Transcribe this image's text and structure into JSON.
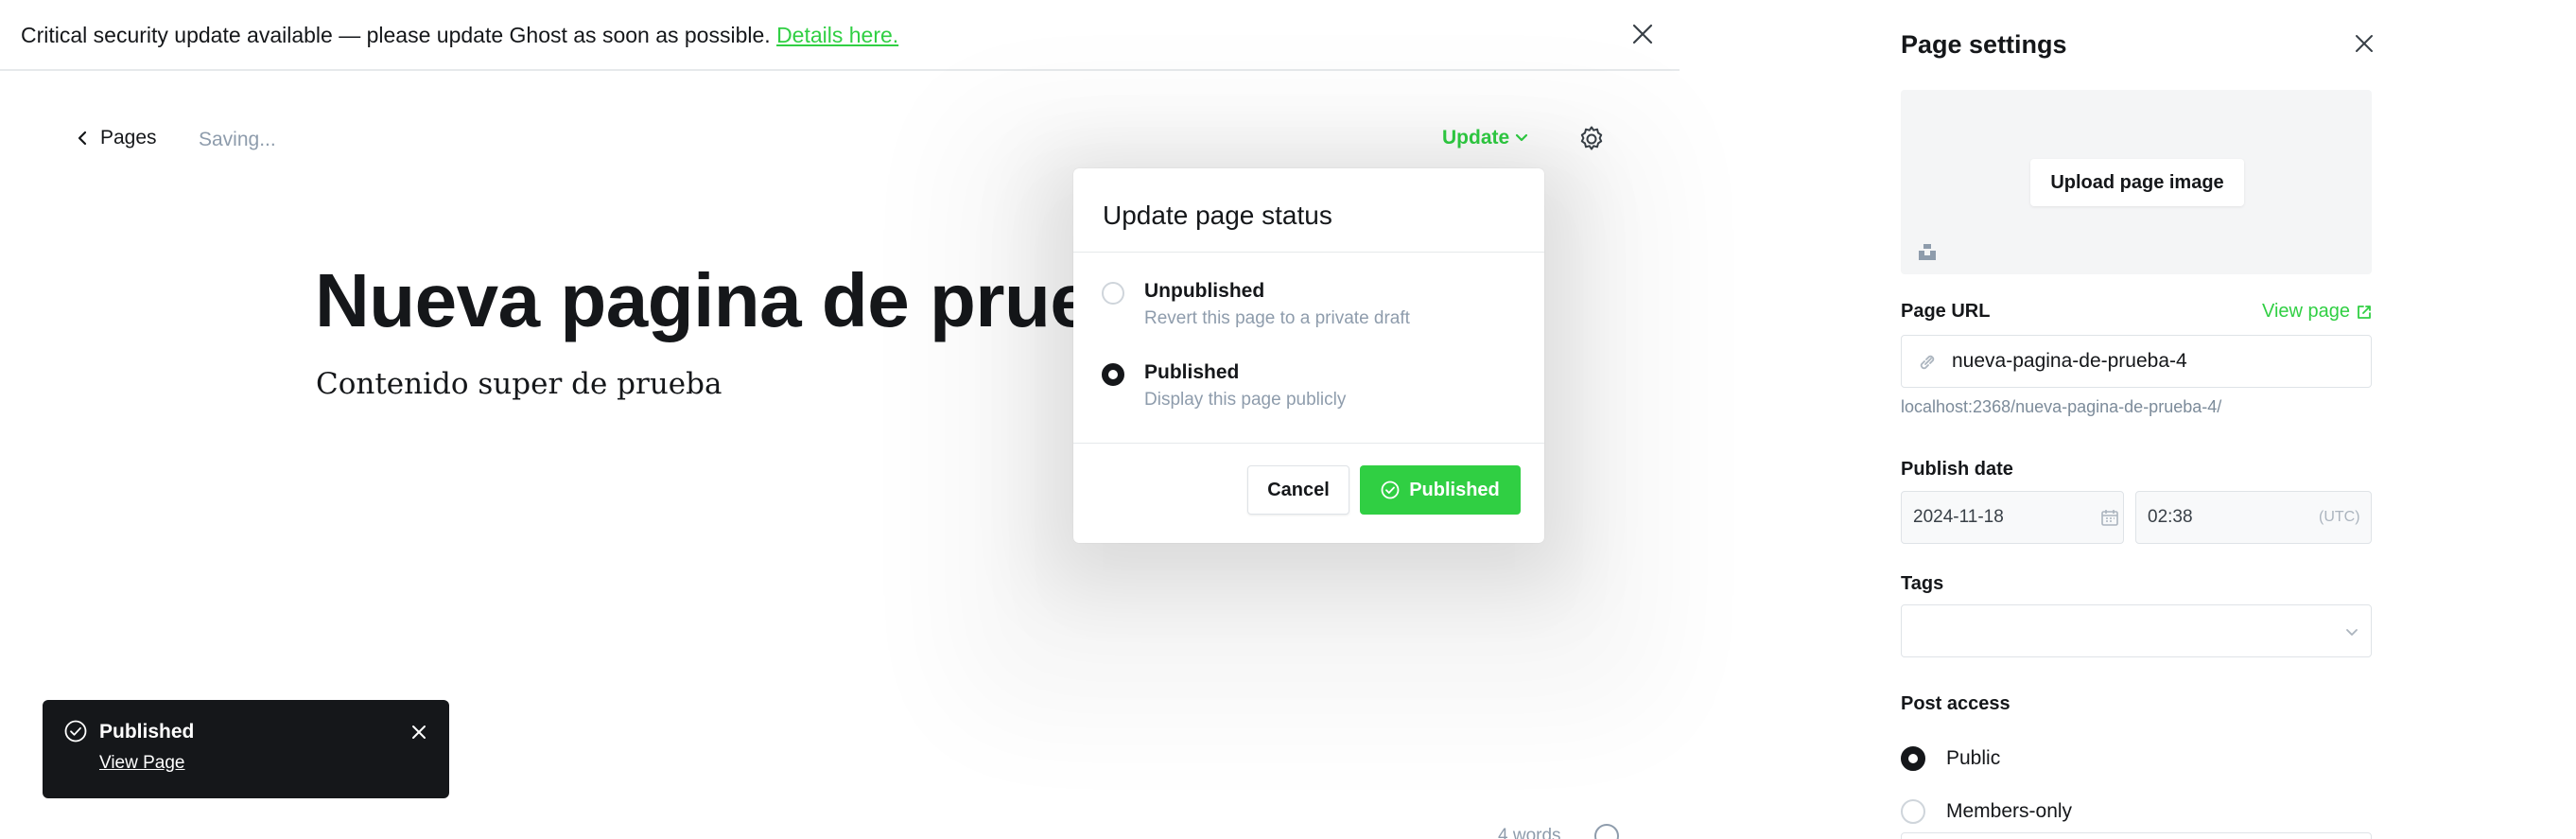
{
  "alert": {
    "message": "Critical security update available — please update Ghost as soon as possible.",
    "link_label": "Details here."
  },
  "editor": {
    "back_label": "Pages",
    "status_text": "Saving...",
    "update_label": "Update",
    "title": "Nueva pagina de prueba",
    "body": "Contenido super de prueba",
    "word_count": "4 words"
  },
  "modal": {
    "title": "Update page status",
    "options": [
      {
        "label": "Unpublished",
        "description": "Revert this page to a private draft",
        "selected": false
      },
      {
        "label": "Published",
        "description": "Display this page publicly",
        "selected": true
      }
    ],
    "cancel_label": "Cancel",
    "confirm_label": "Published"
  },
  "toast": {
    "title": "Published",
    "link_label": "View Page"
  },
  "settings": {
    "title": "Page settings",
    "upload_label": "Upload page image",
    "url_label": "Page URL",
    "view_page_label": "View page",
    "url_value": "nueva-pagina-de-prueba-4",
    "url_hint": "localhost:2368/nueva-pagina-de-prueba-4/",
    "publish_date_label": "Publish date",
    "date_value": "2024-11-18",
    "time_value": "02:38",
    "timezone": "(UTC)",
    "tags_label": "Tags",
    "access_label": "Post access",
    "access_options": [
      {
        "label": "Public",
        "selected": true
      },
      {
        "label": "Members-only",
        "selected": false
      }
    ]
  },
  "colors": {
    "accent_green": "#30cf43",
    "text_dark": "#15171a",
    "muted": "#8e9cac"
  }
}
